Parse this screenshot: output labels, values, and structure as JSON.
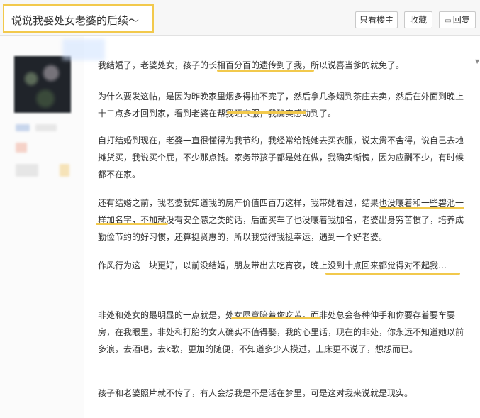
{
  "title": "说说我娶处女老婆的后续～",
  "toolbar": {
    "only_op": "只看楼主",
    "favorite": "收藏",
    "reply": "回复"
  },
  "paragraphs": [
    "我结婚了，老婆处女，孩子的长相百分百的遗传到了我，所以说喜当爹的就免了。",
    "为什么要发这帖，是因为昨晚家里烟多得抽不完了，然后拿几条烟到茶庄去卖，然后在外面到晚上十二点多才回到家，看到老婆在帮我晒衣服，我确实感动到了。",
    "自打结婚到现在，老婆一直很懂得为我节约，我经常给钱她去买衣服，说太贵不舍得，说自己去地摊货买，我说买个屁，不少那点钱。家务带孩子都是她在做，我确实惭愧，因为应酬不少，有时候都不在家。",
    "还有结婚之前，我老婆就知道我的房产价值四百万这样，我带她看过，结果也没嚷着和一些碧池一样加名字，不加就没有安全感之类的话，后面买车了也没嚷着我加名，老婆出身穷苦惯了，培养成勤俭节约的好习惯，还算挺贤惠的，所以我觉得我挺幸运，遇到一个好老婆。",
    "作风行为这一块更好，以前没结婚，朋友带出去吃宵夜，晚上没到十点回来都觉得对不起我…",
    "非处和处女的最明显的一点就是，处女愿意陪着你吃苦，而非处总会各种伸手和你要存着要车要房，在我眼里，非处和打胎的女人确实不值得娶，我的心里话，现在的非处，你永远不知道她以前多浪，去酒吧，去k歌，更加的随便，不知道多少人摸过，上床更不说了，想想而已。",
    "孩子和老婆照片就不传了，有人会想我是不是活在梦里，可是这对我来说就是现实。"
  ],
  "icons": {
    "reply": "comment-icon",
    "expand": "triangle-down-icon"
  },
  "colors": {
    "highlight": "#f2c94c"
  }
}
